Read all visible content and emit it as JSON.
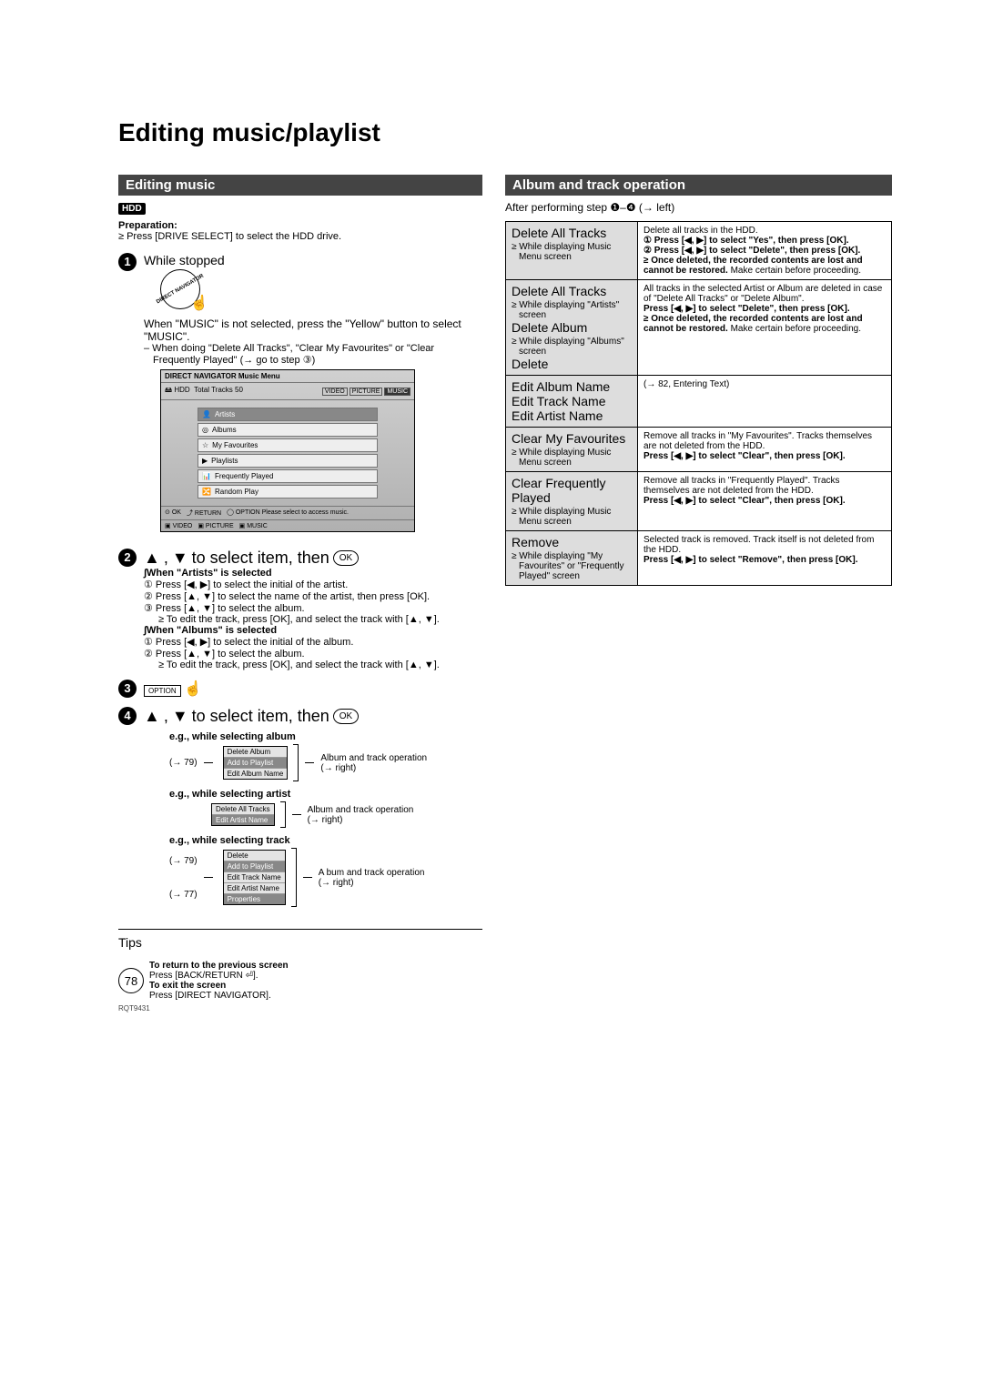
{
  "page": {
    "title": "Editing music/playlist",
    "number": "78",
    "footer_code": "RQT9431"
  },
  "left": {
    "section_title": "Editing music",
    "hdd_badge": "HDD",
    "prep_label": "Preparation:",
    "prep_text": "≥ Press [DRIVE SELECT] to select the HDD drive.",
    "step1_title": "While stopped",
    "step1_body_a": "When \"MUSIC\" is not selected, press the \"Yellow\" button to select \"MUSIC\".",
    "step1_body_b": "– When doing \"Delete All Tracks\", \"Clear My Favourites\" or \"Clear Frequently Played\" (→ go to step ③)",
    "dn": {
      "title": "DIRECT NAVIGATOR  Music Menu",
      "hdd": "HDD",
      "total": "Total Tracks  50",
      "tabs": [
        "VIDEO",
        "PICTURE",
        "MUSIC"
      ],
      "items": [
        "Artists",
        "Albums",
        "My Favourites",
        "Playlists",
        "Frequently Played",
        "Random Play"
      ],
      "footer": [
        "OK",
        "RETURN",
        "OPTION  Please select to access music.",
        "VIDEO",
        "PICTURE",
        "MUSIC"
      ]
    },
    "step2_line": "to select item, then",
    "artists_heading": "∫When \"Artists\" is selected",
    "artists_1": "① Press [◀, ▶] to select the initial of the artist.",
    "artists_2": "② Press [▲, ▼] to select the name of the artist, then press [OK].",
    "artists_3": "③ Press [▲, ▼] to select the album.",
    "artists_edit": "≥ To edit the track, press [OK], and select the track with [▲, ▼].",
    "albums_heading": "∫When \"Albums\" is selected",
    "albums_1": "① Press [◀, ▶] to select the initial of the album.",
    "albums_2": "② Press [▲, ▼] to select the album.",
    "albums_edit": "≥ To edit the track, press [OK], and select the track with [▲, ▼].",
    "step3_label": "OPTION",
    "eg_album_label": "e.g., while selecting album",
    "eg_album_ref": "(→ 79)",
    "eg_album_menu": [
      "Delete Album",
      "Add to Playlist",
      "Edit Album Name"
    ],
    "eg_album_note": "Album and track operation (→ right)",
    "eg_artist_label": "e.g., while selecting artist",
    "eg_artist_menu": [
      "Delete All Tracks",
      "Edit Artist Name"
    ],
    "eg_artist_note": "Album and track operation (→ right)",
    "eg_track_label": "e.g., while selecting track",
    "eg_track_ref1": "(→ 79)",
    "eg_track_ref2": "(→ 77)",
    "eg_track_menu": [
      "Delete",
      "Add to Playlist",
      "Edit Track Name",
      "Edit Artist Name",
      "Properties"
    ],
    "eg_track_note": "A bum and track operation (→ right)",
    "tips_title": "Tips",
    "tips_return_h": "To return to the previous screen",
    "tips_return_b": "Press [BACK/RETURN ⏎].",
    "tips_exit_h": "To exit the screen",
    "tips_exit_b": "Press [DIRECT NAVIGATOR]."
  },
  "right": {
    "section_title": "Album and track operation",
    "after_step": "After performing step ❶–❹ (→ left)",
    "rows": [
      {
        "action": "Delete All Tracks",
        "cond": "≥ While displaying Music Menu screen",
        "desc_plain": "Delete all tracks in the HDD.",
        "desc_b1": "① Press [◀, ▶] to select \"Yes\", then press [OK].",
        "desc_b2": "② Press [◀, ▶] to select \"Delete\", then press [OK].",
        "desc_warn": "≥ Once deleted, the recorded contents are lost and cannot be restored.",
        "desc_tail": " Make certain before proceeding."
      },
      {
        "action_multi": [
          "Delete All Tracks",
          "Delete Album",
          "Delete"
        ],
        "cond_multi": [
          "≥ While displaying \"Artists\" screen",
          "≥ While displaying \"Albums\" screen",
          ""
        ],
        "desc_plain": "All tracks in the selected Artist or Album are deleted in case of \"Delete All Tracks\" or \"Delete Album\".",
        "desc_b1": "Press [◀, ▶] to select \"Delete\", then press [OK].",
        "desc_warn": "≥ Once deleted, the recorded contents are lost and cannot be restored.",
        "desc_tail": " Make certain before proceeding."
      },
      {
        "action_multi": [
          "Edit Album Name",
          "Edit Track Name",
          "Edit Artist Name"
        ],
        "desc_plain": "(→ 82, Entering Text)"
      },
      {
        "action": "Clear My Favourites",
        "cond": "≥ While displaying Music Menu screen",
        "desc_plain": "Remove all tracks in \"My Favourites\". Tracks themselves are not deleted from the HDD.",
        "desc_b1": "Press [◀, ▶] to select \"Clear\", then press [OK]."
      },
      {
        "action": "Clear Frequently Played",
        "cond": "≥ While displaying Music Menu screen",
        "desc_plain": "Remove all tracks in \"Frequently Played\". Tracks themselves are not deleted from the HDD.",
        "desc_b1": "Press [◀, ▶] to select \"Clear\", then press [OK]."
      },
      {
        "action": "Remove",
        "cond": "≥ While displaying \"My Favourites\" or \"Frequently Played\" screen",
        "desc_plain": "Selected track is removed. Track itself is not deleted from the HDD.",
        "desc_b1": "Press [◀, ▶] to select \"Remove\", then press [OK]."
      }
    ]
  }
}
